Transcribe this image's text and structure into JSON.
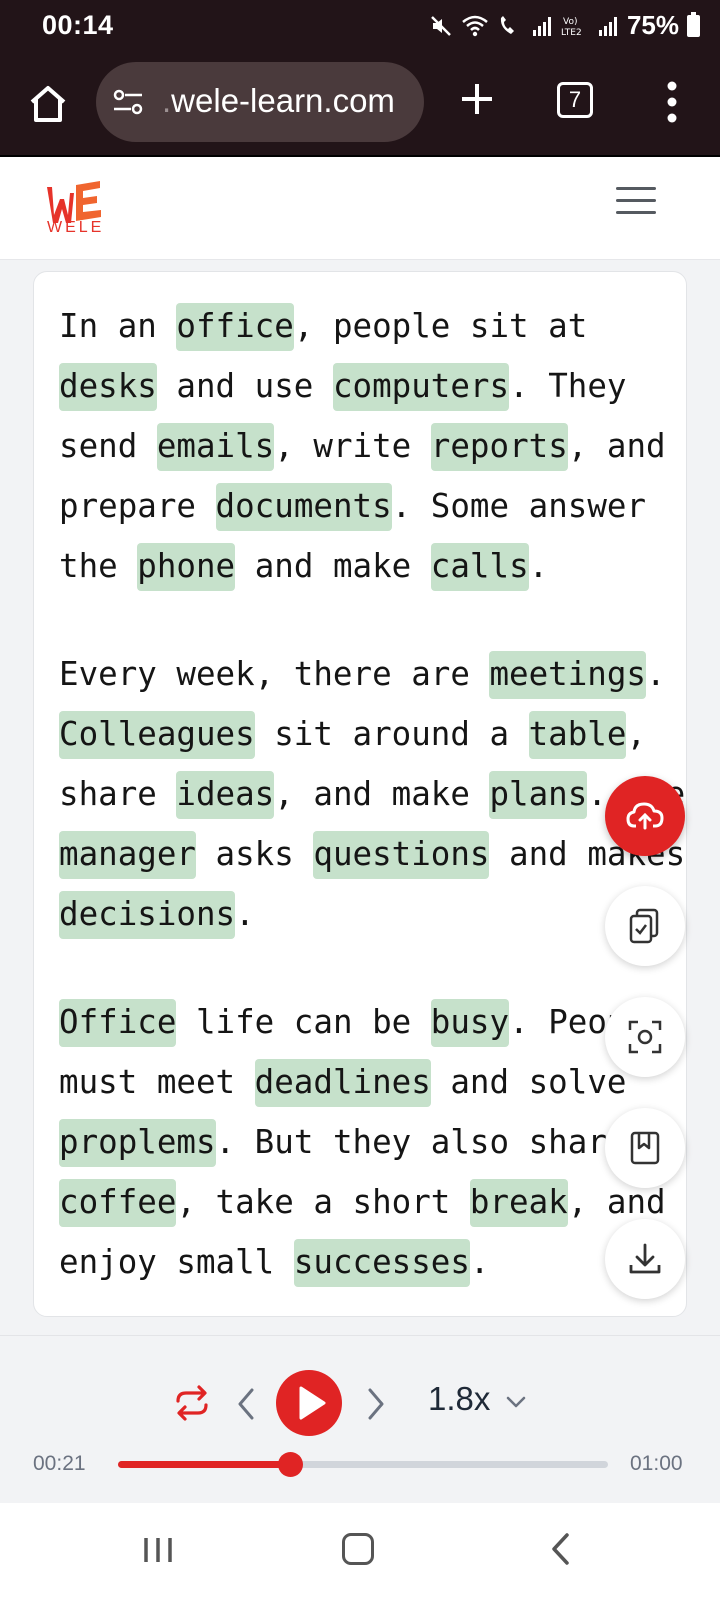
{
  "status_bar": {
    "time": "00:14",
    "battery": "75%"
  },
  "browser": {
    "url_prefix": ".",
    "url_domain": "wele-learn.com",
    "tab_count": "7"
  },
  "site": {
    "logo_text": "WELE",
    "brand_color": "#e6332a"
  },
  "passage": {
    "highlight_color": "#c6e1cb",
    "paragraphs": [
      "In an <hl>office</hl>, people sit at <hl>desks</hl> and use <hl>computers</hl>. They send <hl>emails</hl>, write <hl>reports</hl>, and prepare <hl>documents</hl>. Some answer the <hl>phone</hl> and make <hl>calls</hl>.",
      "Every week, there are <hl>meetings</hl>. <hl>Colleagues</hl> sit around a <hl>table</hl>, share <hl>ideas</hl>, and make <hl>plans</hl>. The <hl>manager</hl> asks <hl>questions</hl> and makes <hl>decisions</hl>.",
      "<hl>Office</hl> life can be <hl>busy</hl>. People must meet <hl>deadlines</hl> and solve <hl>proplems</hl>. But they also share <hl>coffee</hl>, take a short <hl>break</hl>, and enjoy small <hl>successes</hl>."
    ]
  },
  "floating_buttons": [
    {
      "icon": "cloud-upload-icon"
    },
    {
      "icon": "clipboard-check-icon"
    },
    {
      "icon": "focus-scan-icon"
    },
    {
      "icon": "bookmark-icon"
    },
    {
      "icon": "download-icon"
    }
  ],
  "player": {
    "current_time": "00:21",
    "total_time": "01:00",
    "speed": "1.8x",
    "progress": 0.35,
    "accent_color": "#e02424"
  }
}
